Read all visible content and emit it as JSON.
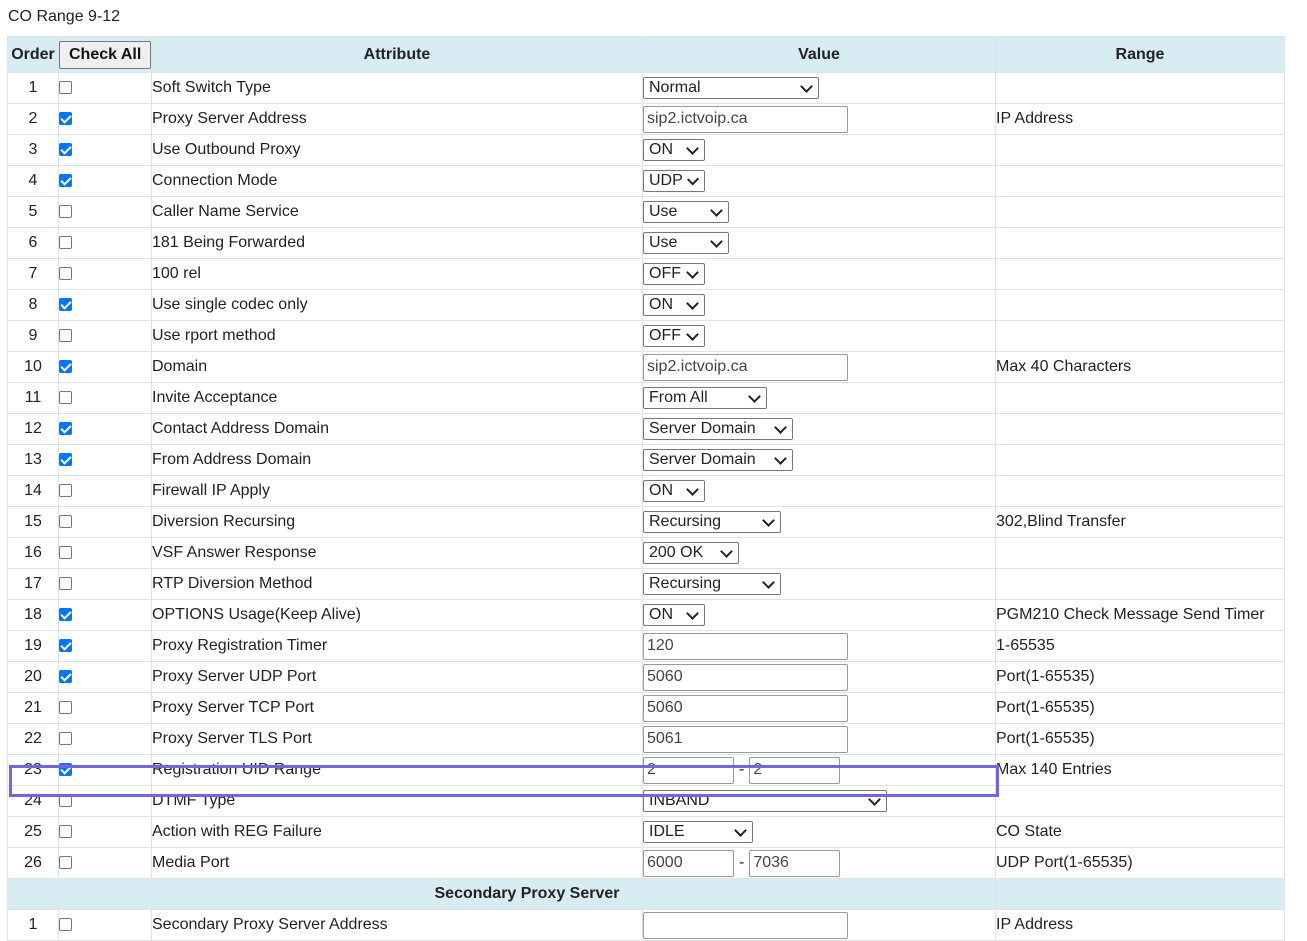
{
  "caption": "CO Range 9-12",
  "header": {
    "order": "Order",
    "check_all": "Check All",
    "attribute": "Attribute",
    "value": "Value",
    "range": "Range"
  },
  "rows": [
    {
      "order": "1",
      "checked": false,
      "attribute": "Soft Switch Type",
      "control": "select",
      "value": "Normal",
      "range": ""
    },
    {
      "order": "2",
      "checked": true,
      "attribute": "Proxy Server Address",
      "control": "text",
      "value": "sip2.ictvoip.ca",
      "range": "IP Address"
    },
    {
      "order": "3",
      "checked": true,
      "attribute": "Use Outbound Proxy",
      "control": "select",
      "value": "ON",
      "range": ""
    },
    {
      "order": "4",
      "checked": true,
      "attribute": "Connection Mode",
      "control": "select",
      "value": "UDP",
      "range": ""
    },
    {
      "order": "5",
      "checked": false,
      "attribute": "Caller Name Service",
      "control": "select",
      "value": "Use",
      "range": ""
    },
    {
      "order": "6",
      "checked": false,
      "attribute": "181 Being Forwarded",
      "control": "select",
      "value": "Use",
      "range": ""
    },
    {
      "order": "7",
      "checked": false,
      "attribute": "100 rel",
      "control": "select",
      "value": "OFF",
      "range": ""
    },
    {
      "order": "8",
      "checked": true,
      "attribute": "Use single codec only",
      "control": "select",
      "value": "ON",
      "range": ""
    },
    {
      "order": "9",
      "checked": false,
      "attribute": "Use rport method",
      "control": "select",
      "value": "OFF",
      "range": ""
    },
    {
      "order": "10",
      "checked": true,
      "attribute": "Domain",
      "control": "text",
      "value": "sip2.ictvoip.ca",
      "range": "Max 40 Characters"
    },
    {
      "order": "11",
      "checked": false,
      "attribute": "Invite Acceptance",
      "control": "select",
      "value": "From All",
      "range": ""
    },
    {
      "order": "12",
      "checked": true,
      "attribute": "Contact Address Domain",
      "control": "select",
      "value": "Server Domain",
      "range": ""
    },
    {
      "order": "13",
      "checked": true,
      "attribute": "From Address Domain",
      "control": "select",
      "value": "Server Domain",
      "range": ""
    },
    {
      "order": "14",
      "checked": false,
      "attribute": "Firewall IP Apply",
      "control": "select",
      "value": "ON",
      "range": ""
    },
    {
      "order": "15",
      "checked": false,
      "attribute": "Diversion Recursing",
      "control": "select",
      "value": "Recursing",
      "range": "302,Blind Transfer"
    },
    {
      "order": "16",
      "checked": false,
      "attribute": "VSF Answer Response",
      "control": "select",
      "value": "200 OK",
      "range": ""
    },
    {
      "order": "17",
      "checked": false,
      "attribute": "RTP Diversion Method",
      "control": "select",
      "value": "Recursing",
      "range": ""
    },
    {
      "order": "18",
      "checked": true,
      "attribute": "OPTIONS Usage(Keep Alive)",
      "control": "select",
      "value": "ON",
      "range": "PGM210 Check Message Send Timer"
    },
    {
      "order": "19",
      "checked": true,
      "attribute": "Proxy Registration Timer",
      "control": "text",
      "value": "120",
      "range": "1-65535"
    },
    {
      "order": "20",
      "checked": true,
      "attribute": "Proxy Server UDP Port",
      "control": "text",
      "value": "5060",
      "range": "Port(1-65535)"
    },
    {
      "order": "21",
      "checked": false,
      "attribute": "Proxy Server TCP Port",
      "control": "text",
      "value": "5060",
      "range": "Port(1-65535)"
    },
    {
      "order": "22",
      "checked": false,
      "attribute": "Proxy Server TLS Port",
      "control": "text",
      "value": "5061",
      "range": "Port(1-65535)"
    },
    {
      "order": "23",
      "checked": true,
      "attribute": "Registration UID Range",
      "control": "pair",
      "value": "2",
      "value2": "2",
      "separator": "-",
      "range": "Max 140 Entries"
    },
    {
      "order": "24",
      "checked": false,
      "attribute": "DTMF Type",
      "control": "select",
      "value": "INBAND",
      "range": ""
    },
    {
      "order": "25",
      "checked": false,
      "attribute": "Action with REG Failure",
      "control": "select",
      "value": "IDLE",
      "range": "CO State"
    },
    {
      "order": "26",
      "checked": false,
      "attribute": "Media Port",
      "control": "pair",
      "value": "6000",
      "value2": "7036",
      "separator": "-",
      "range": "UDP Port(1-65535)"
    }
  ],
  "section": {
    "label": "Secondary Proxy Server"
  },
  "section_rows": [
    {
      "order": "1",
      "checked": false,
      "attribute": "Secondary Proxy Server Address",
      "control": "text",
      "value": "",
      "range": "IP Address"
    }
  ],
  "colors": {
    "header_bg": "#d8ecf4",
    "highlight": "#7066e0",
    "checkbox_on": "#0075ff"
  }
}
